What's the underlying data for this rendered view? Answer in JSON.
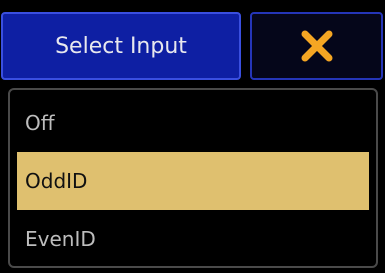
{
  "dialog": {
    "title": "Select Input",
    "close_icon": "close-x-icon",
    "accent_color": "#f5a623"
  },
  "options": {
    "items": [
      {
        "label": "Off",
        "selected": false
      },
      {
        "label": "OddID",
        "selected": true
      },
      {
        "label": "EvenID",
        "selected": false
      }
    ],
    "selected_color": "#dfc06f"
  }
}
